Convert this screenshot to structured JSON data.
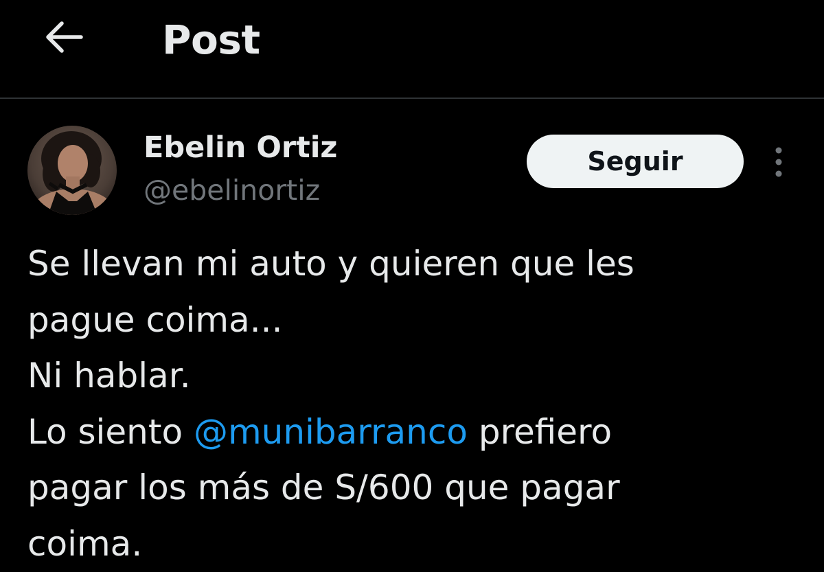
{
  "header": {
    "back_icon": "arrow-left-icon",
    "title": "Post"
  },
  "author": {
    "avatar_icon": "user-avatar-photo",
    "name": "Ebelin Ortiz",
    "handle": "@ebelinortiz"
  },
  "actions": {
    "follow_label": "Seguir",
    "more_icon": "more-vertical-icon"
  },
  "tweet": {
    "line1": "Se llevan mi auto y quieren que les",
    "line2": "pague coima...",
    "line3": "Ni hablar.",
    "line4_before": "Lo siento ",
    "mention": "@munibarranco",
    "line4_after": " prefiero",
    "line5": "pagar los más de S/600 que pagar",
    "line6": "coima."
  },
  "colors": {
    "background": "#000000",
    "text_primary": "#e7e9ea",
    "text_secondary": "#71767b",
    "link": "#1d9bf0",
    "divider": "#2f3336",
    "follow_button_bg": "#eff3f4",
    "follow_button_text": "#0f1419"
  }
}
